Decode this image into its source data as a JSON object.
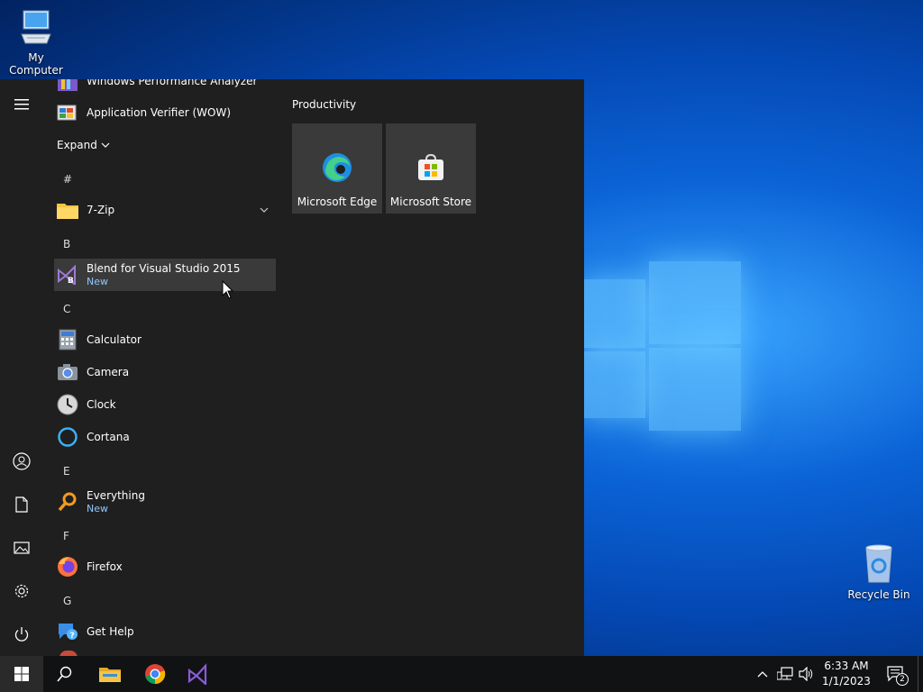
{
  "desktop": {
    "my_computer_label": "My Computer",
    "recycle_bin_label": "Recycle Bin"
  },
  "start_menu": {
    "apps_top": [
      {
        "label": "Windows Performance Analyzer",
        "icon": "performance-analyzer-icon"
      },
      {
        "label": "Application Verifier (WOW)",
        "icon": "app-verifier-icon"
      }
    ],
    "expand_label": "Expand",
    "sections": [
      {
        "letter": "#",
        "apps": [
          {
            "label": "7-Zip",
            "icon": "folder-icon",
            "sub": ""
          }
        ]
      },
      {
        "letter": "B",
        "apps": [
          {
            "label": "Blend for Visual Studio 2015",
            "icon": "blend-icon",
            "sub": "New"
          }
        ]
      },
      {
        "letter": "C",
        "apps": [
          {
            "label": "Calculator",
            "icon": "calculator-icon",
            "sub": ""
          },
          {
            "label": "Camera",
            "icon": "camera-icon",
            "sub": ""
          },
          {
            "label": "Clock",
            "icon": "clock-icon",
            "sub": ""
          },
          {
            "label": "Cortana",
            "icon": "cortana-icon",
            "sub": ""
          }
        ]
      },
      {
        "letter": "E",
        "apps": [
          {
            "label": "Everything",
            "icon": "search-magnifier-icon",
            "sub": "New"
          }
        ]
      },
      {
        "letter": "F",
        "apps": [
          {
            "label": "Firefox",
            "icon": "firefox-icon",
            "sub": ""
          }
        ]
      },
      {
        "letter": "G",
        "apps": [
          {
            "label": "Get Help",
            "icon": "help-icon",
            "sub": ""
          }
        ]
      }
    ],
    "tiles_group": "Productivity",
    "tiles": [
      {
        "label": "Microsoft Edge",
        "icon": "edge-icon"
      },
      {
        "label": "Microsoft Store",
        "icon": "store-icon"
      }
    ]
  },
  "taskbar": {
    "time": "6:33 AM",
    "date": "1/1/2023",
    "notification_count": "2"
  },
  "colors": {
    "menu_bg": "#1f1f1f",
    "tile_bg": "#3a3a3a",
    "new_badge": "#8fc8ff",
    "taskbar_bg": "#101214"
  }
}
